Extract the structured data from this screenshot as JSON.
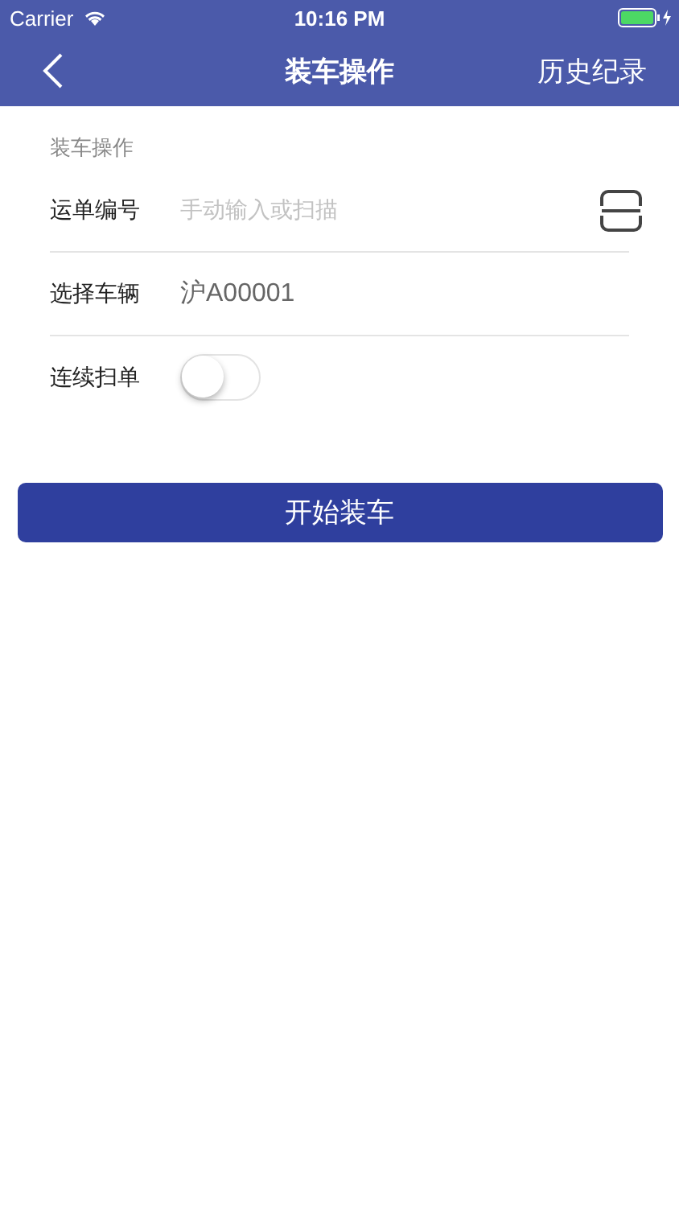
{
  "status_bar": {
    "carrier": "Carrier",
    "time": "10:16 PM"
  },
  "nav": {
    "title": "装车操作",
    "action": "历史纪录"
  },
  "section": {
    "title": "装车操作"
  },
  "rows": [
    {
      "kind": "input",
      "label": "运单编号",
      "placeholder": "手动输入或扫描"
    },
    {
      "kind": "value",
      "label": "选择车辆",
      "value": "沪A00001"
    },
    {
      "kind": "toggle",
      "label": "连续扫单",
      "on": false
    }
  ],
  "button": "开始装车"
}
